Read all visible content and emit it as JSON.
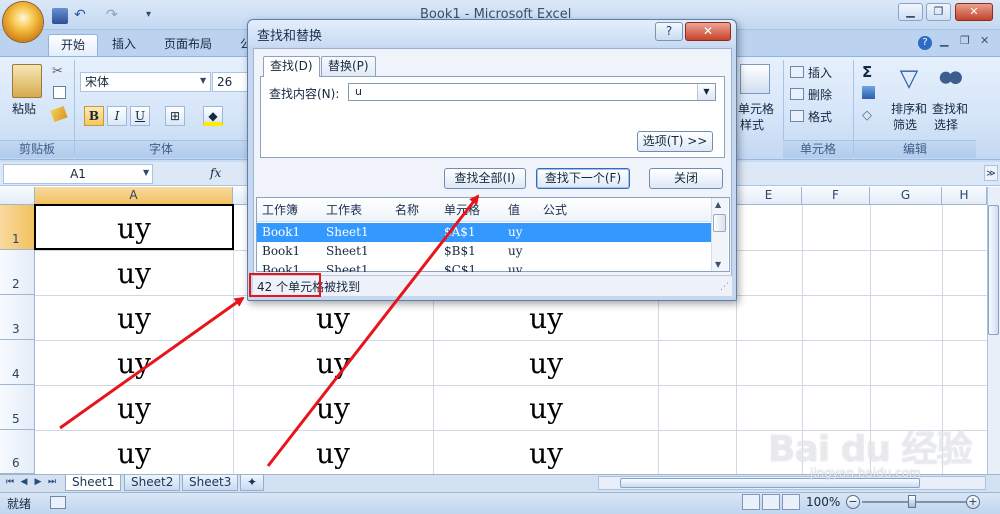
{
  "window": {
    "title": "Book1 - Microsoft Excel",
    "min_label": "▁",
    "max_label": "❐",
    "close_label": "✕"
  },
  "ribbon": {
    "tabs": [
      "开始",
      "插入",
      "页面布局",
      "公"
    ],
    "clipboard": {
      "paste_label": "粘贴",
      "group_label": "剪贴板"
    },
    "font": {
      "name": "宋体",
      "size": "26",
      "group_label": "字体",
      "bold": "B",
      "italic": "I",
      "underline": "U"
    },
    "cells": {
      "insert_label": "插入",
      "delete_label": "删除",
      "format_label": "格式",
      "style_label_1": "单元格",
      "style_label_2": "样式",
      "group_label": "单元格"
    },
    "editing": {
      "sort_label_1": "排序和",
      "sort_label_2": "筛选",
      "find_label_1": "查找和",
      "find_label_2": "选择",
      "group_label": "编辑"
    }
  },
  "formula_bar": {
    "name_box": "A1",
    "fx": "fx"
  },
  "grid": {
    "columns": [
      "A",
      "E",
      "F",
      "G",
      "H"
    ],
    "rows": [
      "1",
      "2",
      "3",
      "4",
      "5",
      "6"
    ],
    "cell_value": "uy"
  },
  "sheets": [
    "Sheet1",
    "Sheet2",
    "Sheet3"
  ],
  "status": {
    "ready": "就绪",
    "zoom": "100%"
  },
  "dialog": {
    "title": "查找和替换",
    "help": "?",
    "close": "✕",
    "tabs": [
      "查找(D)",
      "替换(P)"
    ],
    "find_label": "查找内容(N):",
    "find_value": "u",
    "options_button": "选项(T) >>",
    "find_all_button": "查找全部(I)",
    "find_next_button": "查找下一个(F)",
    "close_button": "关闭",
    "result_headers": [
      "工作簿",
      "工作表",
      "名称",
      "单元格",
      "值",
      "公式"
    ],
    "results": [
      {
        "book": "Book1",
        "sheet": "Sheet1",
        "cell": "$A$1",
        "value": "uy"
      },
      {
        "book": "Book1",
        "sheet": "Sheet1",
        "cell": "$B$1",
        "value": "uy"
      },
      {
        "book": "Book1",
        "sheet": "Sheet1",
        "cell": "$C$1",
        "value": "uy"
      }
    ],
    "status_text": "42 个单元格被找到"
  },
  "watermark": {
    "brand": "Bai du 经验",
    "url": "jingyan.baidu.com"
  },
  "colors": {
    "highlight": "#3399ff",
    "annotation": "#e8141c"
  }
}
